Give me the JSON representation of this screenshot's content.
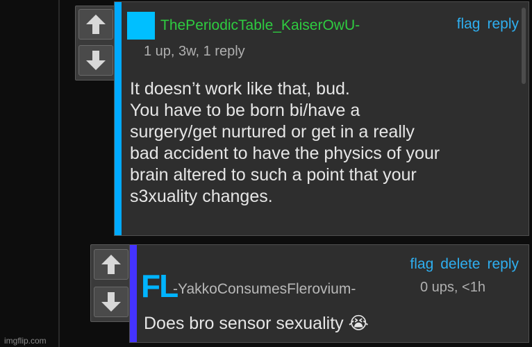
{
  "comments": [
    {
      "username": "ThePeriodicTable_KaiserOwU-",
      "username_color": "#2ecc40",
      "accent_color": "#00aaff",
      "meta": "1 up, 3w, 1 reply",
      "actions": [
        "flag",
        "reply"
      ],
      "body_lines": [
        "It doesn’t work like that, bud.",
        "You have to be born bi/have a",
        "surgery/get nurtured or get in a really",
        "bad accident to have the physics of your",
        "brain altered to such a point that your",
        "s3xuality changes."
      ]
    },
    {
      "username": "-YakkoConsumesFlerovium-",
      "username_color": "#b8b8b8",
      "accent_color": "#4433ff",
      "avatar_text": "FL",
      "meta": "0 ups, <1h",
      "actions": [
        "flag",
        "delete",
        "reply"
      ],
      "body": "Does bro sensor sexuality 😭"
    }
  ],
  "watermark": "imgflip.com"
}
